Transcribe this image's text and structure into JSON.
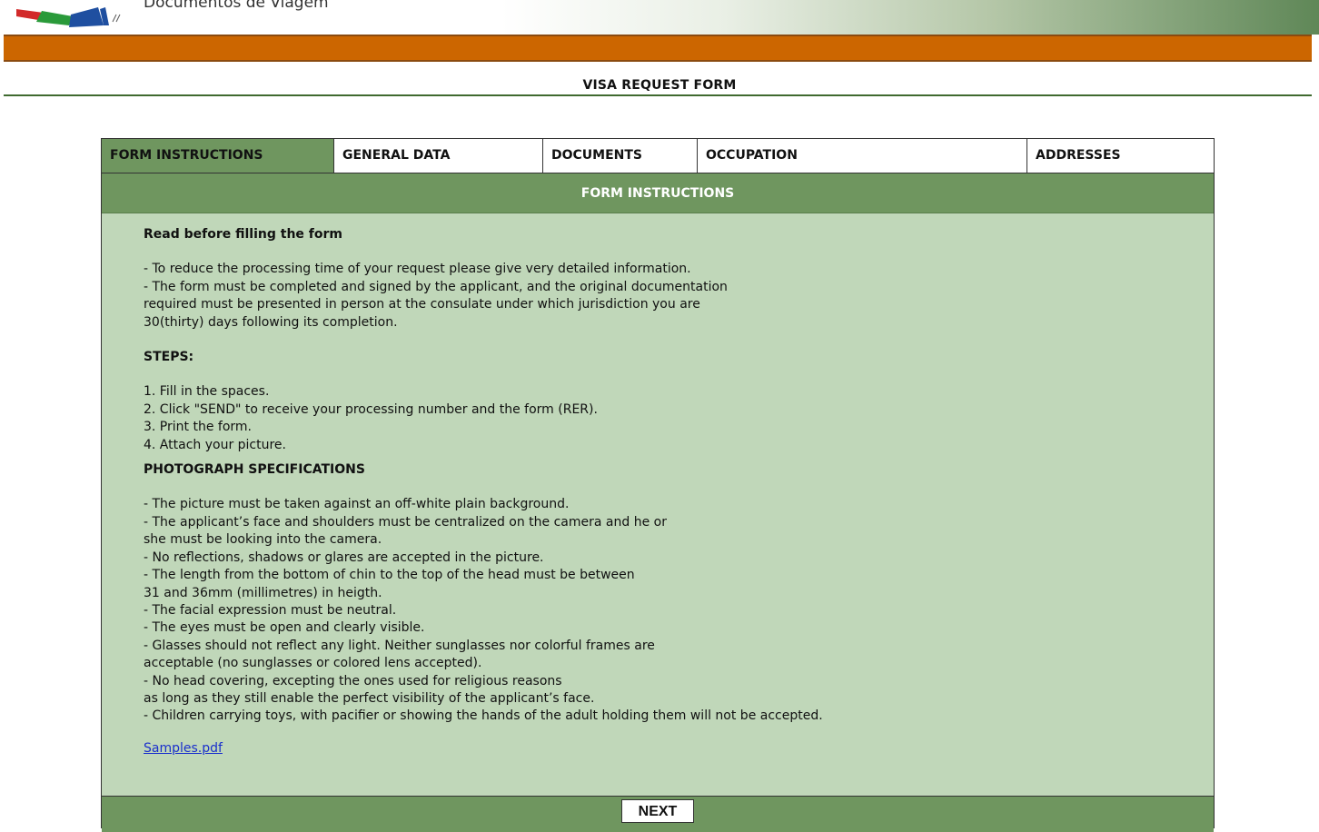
{
  "header": {
    "site_title": "Documentos de Viagem",
    "logo_icon": "flag-stripes-logo-icon",
    "brand_colors": {
      "orange": "#cc6600",
      "green": "#6f965f",
      "panel": "#c0d7b9"
    }
  },
  "page": {
    "heading": "VISA REQUEST FORM"
  },
  "tabs": [
    {
      "label": "FORM INSTRUCTIONS",
      "active": true
    },
    {
      "label": "GENERAL DATA",
      "active": false
    },
    {
      "label": "DOCUMENTS",
      "active": false
    },
    {
      "label": "OCCUPATION",
      "active": false
    },
    {
      "label": "ADDRESSES",
      "active": false
    }
  ],
  "section": {
    "title": "FORM INSTRUCTIONS",
    "read_before_title": "Read before filling the form",
    "read_before_text": "- To reduce the processing time of your request please give very detailed information.\n- The form must be completed and signed by the applicant, and the original documentation\nrequired must be presented in person at the consulate under which jurisdiction you are\n30(thirty) days following its completion.",
    "steps_title": "STEPS:",
    "steps_text": "1. Fill in the spaces.\n2. Click \"SEND\" to receive your processing number and the form (RER).\n3. Print the form.\n4. Attach your picture.",
    "photo_title": "PHOTOGRAPH SPECIFICATIONS",
    "photo_text": "- The picture must be taken against an off-white plain background.\n- The applicant’s face and shoulders must be centralized on the camera and he or\nshe must be looking into the camera.\n- No reflections, shadows or glares are accepted in the picture.\n- The length from the bottom of chin to the top of the head must be between\n31 and 36mm (millimetres) in heigth.\n- The facial expression must be neutral.\n- The eyes must be open and clearly visible.\n- Glasses should not reflect any light. Neither sunglasses nor colorful frames are\nacceptable (no sunglasses or colored lens accepted).\n- No head covering, excepting the ones used for religious reasons\nas long as they still enable the perfect visibility of the applicant’s face.\n- Children carrying toys, with pacifier or showing the hands of the adult holding them will not be accepted.",
    "samples_link": "Samples.pdf"
  },
  "footer": {
    "next_label": "NEXT"
  }
}
